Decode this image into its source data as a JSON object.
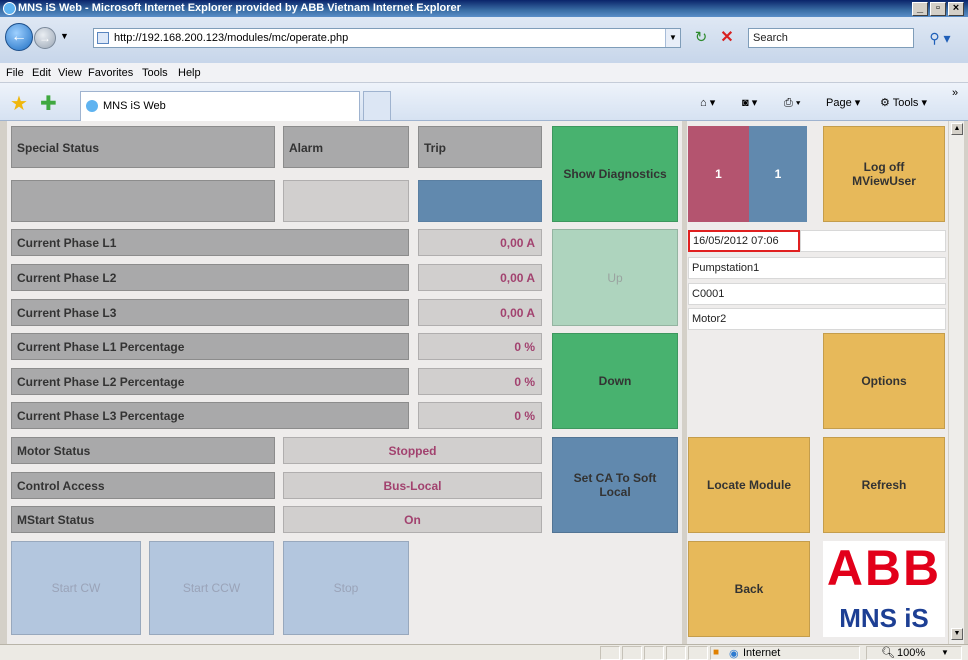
{
  "window": {
    "title": "MNS iS Web - Microsoft Internet Explorer provided by ABB Vietnam Internet Explorer"
  },
  "address": {
    "url": "http://192.168.200.123/modules/mc/operate.php"
  },
  "search": {
    "placeholder": "Search"
  },
  "menu": [
    "File",
    "Edit",
    "View",
    "Favorites",
    "Tools",
    "Help"
  ],
  "tab": {
    "title": "MNS iS Web"
  },
  "toolbar": {
    "page_label": "Page",
    "tools_label": "Tools"
  },
  "status_panel": {
    "special_status": "Special Status",
    "alarm": "Alarm",
    "trip": "Trip"
  },
  "measurements": [
    {
      "label": "Current Phase L1",
      "value": "0,00 A"
    },
    {
      "label": "Current Phase L2",
      "value": "0,00 A"
    },
    {
      "label": "Current Phase L3",
      "value": "0,00 A"
    },
    {
      "label": "Current Phase L1 Percentage",
      "value": "0 %"
    },
    {
      "label": "Current Phase L2 Percentage",
      "value": "0 %"
    },
    {
      "label": "Current Phase L3 Percentage",
      "value": "0 %"
    }
  ],
  "states": [
    {
      "label": "Motor Status",
      "value": "Stopped"
    },
    {
      "label": "Control Access",
      "value": "Bus-Local"
    },
    {
      "label": "MStart Status",
      "value": "On"
    }
  ],
  "buttons": {
    "show_diagnostics": "Show Diagnostics",
    "up": "Up",
    "down": "Down",
    "set_ca": "Set CA To Soft Local",
    "start_cw": "Start CW",
    "start_ccw": "Start CCW",
    "stop": "Stop",
    "log_off": "Log off MViewUser",
    "options": "Options",
    "locate_module": "Locate Module",
    "refresh": "Refresh",
    "back": "Back"
  },
  "counters": {
    "left": "1",
    "right": "1"
  },
  "info": {
    "datetime": "16/05/2012 07:06",
    "station": "Pumpstation1",
    "code": "C0001",
    "motor": "Motor2"
  },
  "logo": {
    "brand": "ABB",
    "product": "MNS iS"
  },
  "statusbar": {
    "zone": "Internet",
    "zoom": "100%"
  },
  "colors": {
    "green": "#48b26f",
    "blue": "#6189ae",
    "yellow": "#e7b95a",
    "pink": "#b4546f",
    "value_text": "#a2426f",
    "abb_red": "#e2001a",
    "logo_blue": "#1d3f94"
  }
}
